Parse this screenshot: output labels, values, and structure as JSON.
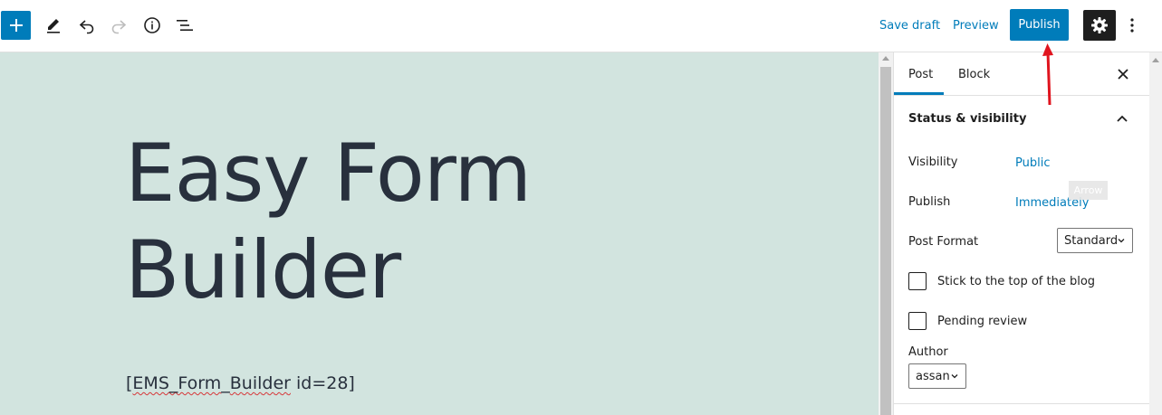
{
  "toolbar": {
    "save_draft": "Save draft",
    "preview": "Preview",
    "publish": "Publish"
  },
  "editor": {
    "title_line1": "Easy Form",
    "title_line2": "Builder",
    "shortcode_prefix": "[",
    "shortcode_word1": "EMS_Form",
    "shortcode_word2": "Builder",
    "shortcode_rest": " id=28]",
    "shortcode_sep": "_"
  },
  "sidebar": {
    "tabs": [
      {
        "label": "Post"
      },
      {
        "label": "Block"
      }
    ],
    "panel_title": "Status & visibility",
    "visibility_label": "Visibility",
    "visibility_value": "Public",
    "publish_label": "Publish",
    "publish_value": "Immediately",
    "post_format_label": "Post Format",
    "post_format_value": "Standard",
    "sticky_label": "Stick to the top of the blog",
    "pending_label": "Pending review",
    "author_label": "Author",
    "author_value": "assan"
  },
  "tooltip": "Arrow",
  "colors": {
    "accent": "#007cba",
    "canvas_bg": "#d2e4df",
    "annotation": "#e0141e"
  }
}
